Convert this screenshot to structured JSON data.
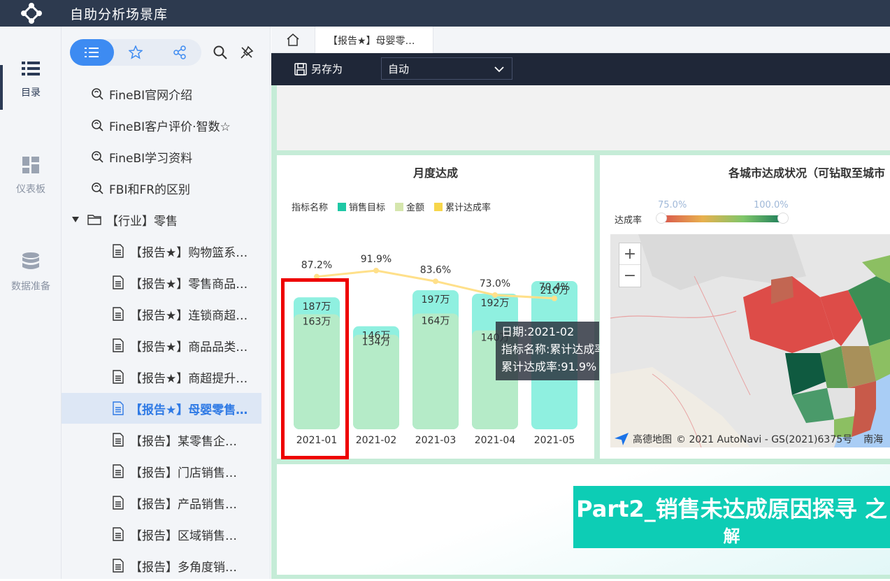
{
  "app": {
    "title": "自助分析场景库"
  },
  "rail": [
    {
      "label": "目录",
      "icon": "list-icon"
    },
    {
      "label": "仪表板",
      "icon": "dashboard-icon"
    },
    {
      "label": "数据准备",
      "icon": "database-icon"
    }
  ],
  "tree": {
    "items": [
      {
        "label": "FineBI官网介绍",
        "type": "link"
      },
      {
        "label": "FineBI客户评价·智数☆",
        "type": "link"
      },
      {
        "label": "FineBI学习资料",
        "type": "link"
      },
      {
        "label": "FBI和FR的区别",
        "type": "link"
      },
      {
        "label": "【行业】零售",
        "type": "folder"
      },
      {
        "label": "【报告★】购物篮系…",
        "type": "report"
      },
      {
        "label": "【报告★】零售商品…",
        "type": "report"
      },
      {
        "label": "【报告★】连锁商超…",
        "type": "report"
      },
      {
        "label": "【报告★】商品品类…",
        "type": "report"
      },
      {
        "label": "【报告★】商超提升…",
        "type": "report"
      },
      {
        "label": "【报告★】母婴零售…",
        "type": "report",
        "selected": true
      },
      {
        "label": "【报告】某零售企…",
        "type": "report"
      },
      {
        "label": "【报告】门店销售…",
        "type": "report"
      },
      {
        "label": "【报告】产品销售…",
        "type": "report"
      },
      {
        "label": "【报告】区域销售…",
        "type": "report"
      },
      {
        "label": "【报告】多角度销…",
        "type": "report"
      }
    ]
  },
  "tabs": {
    "current": "【报告★】母婴零…"
  },
  "toolbar": {
    "save_as": "另存为",
    "mode": "自动"
  },
  "monthly": {
    "title": "月度达成",
    "legend_title": "指标名称",
    "tooltip": {
      "line1": "日期:2021-02",
      "line2": "指标名称:累计达成率",
      "line3": "累计达成率:91.9%"
    }
  },
  "chart_data": {
    "type": "bar",
    "title": "月度达成",
    "categories": [
      "2021-01",
      "2021-02",
      "2021-03",
      "2021-04",
      "2021-05"
    ],
    "series": [
      {
        "name": "销售目标",
        "values": [
          187,
          146,
          197,
          192,
          210
        ],
        "labels": [
          "187万",
          "146万",
          "197万",
          "192万",
          "210万"
        ],
        "color": "#8ff0e0"
      },
      {
        "name": "金额",
        "values": [
          163,
          134,
          164,
          140,
          0
        ],
        "labels": [
          "163万",
          "134万",
          "164万",
          "140万",
          ""
        ],
        "color": "#b5ebc8"
      },
      {
        "name": "累计达成率",
        "values": [
          87.2,
          91.9,
          83.6,
          73.0,
          70.4
        ],
        "labels": [
          "87.2%",
          "91.9%",
          "83.6%",
          "73.0%",
          "70.4%"
        ],
        "color": "#ffe08a"
      }
    ],
    "legend_colors": [
      "#1ec8a5",
      "#d5e6ad",
      "#f7d64a"
    ],
    "ylim": [
      0,
      210
    ],
    "ylim_rate": [
      60,
      100
    ]
  },
  "map": {
    "title": "各城市达成状况（可钻取至城市",
    "scale_label": "达成率",
    "scale_min": "75.0%",
    "scale_max": "100.0%",
    "attribution": "© 2021 AutoNavi - GS(2021)6375号",
    "brand": "高德地图",
    "sea_label": "南海",
    "zoom_in": "+",
    "zoom_out": "−"
  },
  "banner": {
    "line1": "Part2_销售未达成原因探寻 之",
    "line2": "解"
  }
}
